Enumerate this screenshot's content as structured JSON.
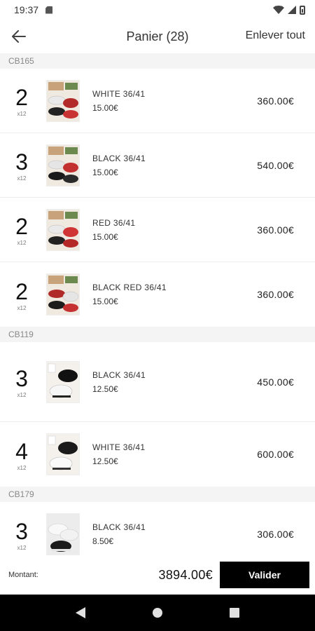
{
  "status": {
    "time": "19:37"
  },
  "header": {
    "title": "Panier (28)",
    "clear_all": "Enlever tout"
  },
  "groups": [
    {
      "code": "CB165",
      "items": [
        {
          "qty": "2",
          "pack": "x12",
          "name": "WHITE 36/41",
          "unit_price": "15.00€",
          "total": "360.00€"
        },
        {
          "qty": "3",
          "pack": "x12",
          "name": "BLACK 36/41",
          "unit_price": "15.00€",
          "total": "540.00€"
        },
        {
          "qty": "2",
          "pack": "x12",
          "name": "RED 36/41",
          "unit_price": "15.00€",
          "total": "360.00€"
        },
        {
          "qty": "2",
          "pack": "x12",
          "name": "BLACK RED 36/41",
          "unit_price": "15.00€",
          "total": "360.00€"
        }
      ]
    },
    {
      "code": "CB119",
      "items": [
        {
          "qty": "3",
          "pack": "x12",
          "name": "BLACK 36/41",
          "unit_price": "12.50€",
          "total": "450.00€"
        },
        {
          "qty": "4",
          "pack": "x12",
          "name": "WHITE 36/41",
          "unit_price": "12.50€",
          "total": "600.00€"
        }
      ]
    },
    {
      "code": "CB179",
      "items": [
        {
          "qty": "3",
          "pack": "x12",
          "name": "BLACK 36/41",
          "unit_price": "8.50€",
          "total": "306.00€"
        }
      ]
    }
  ],
  "footer": {
    "amount_label": "Montant:",
    "amount_value": "3894.00€",
    "validate_label": "Valider"
  },
  "colors": {
    "accent": "#000000",
    "group_bg": "#f4f4f4"
  },
  "icons": {
    "back": "arrow-left-icon",
    "nav_back": "triangle-back-icon",
    "nav_home": "circle-home-icon",
    "nav_recent": "square-recent-icon"
  }
}
